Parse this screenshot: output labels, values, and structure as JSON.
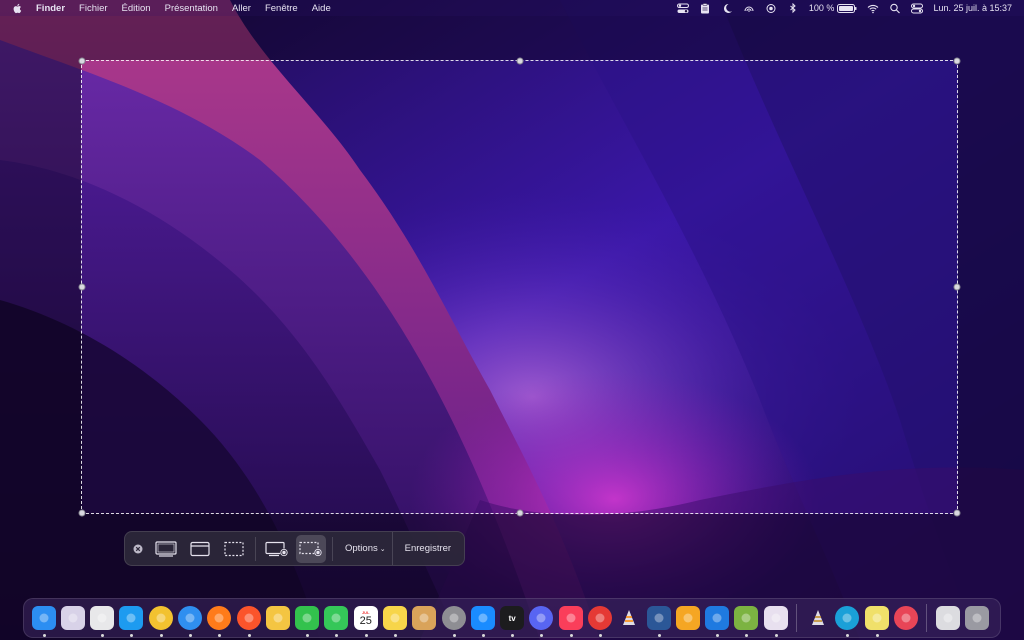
{
  "menubar": {
    "app_name": "Finder",
    "menus": [
      "Fichier",
      "Édition",
      "Présentation",
      "Aller",
      "Fenêtre",
      "Aide"
    ],
    "battery_percent": "100 %",
    "datetime": "Lun. 25 juil. à  15:37"
  },
  "toolbar": {
    "options_label": "Options",
    "record_label": "Enregistrer",
    "buttons": [
      "close-icon",
      "capture-entire-screen-icon",
      "capture-selected-window-icon",
      "capture-selected-portion-icon",
      "record-entire-screen-icon",
      "record-selected-portion-icon"
    ],
    "active": "record-selected-portion-icon"
  },
  "dock": {
    "calendar_day": "25",
    "calendar_month": "JUL",
    "tv_label": "tv",
    "apps": [
      {
        "name": "finder",
        "color": "#2c8ef2"
      },
      {
        "name": "launchpad",
        "color": "#d8d2e8"
      },
      {
        "name": "notes-dark",
        "color": "#e8e8ea"
      },
      {
        "name": "twitter",
        "color": "#1d9bf0"
      },
      {
        "name": "chrome",
        "color": "#f2c230"
      },
      {
        "name": "safari",
        "color": "#2f8ff0"
      },
      {
        "name": "firefox",
        "color": "#ff7b1a"
      },
      {
        "name": "brave",
        "color": "#fb542b"
      },
      {
        "name": "photos",
        "color": "#f4c542"
      },
      {
        "name": "facetime",
        "color": "#33c24d"
      },
      {
        "name": "messages",
        "color": "#35c759"
      },
      {
        "name": "calendar",
        "color": "#ffffff"
      },
      {
        "name": "notes",
        "color": "#f7d54a"
      },
      {
        "name": "preview",
        "color": "#d9a35a"
      },
      {
        "name": "system-preferences",
        "color": "#8e8e93"
      },
      {
        "name": "app-store",
        "color": "#1a8cff"
      },
      {
        "name": "apple-tv",
        "color": "#1c1c1e"
      },
      {
        "name": "discord",
        "color": "#5865f2"
      },
      {
        "name": "music",
        "color": "#fa3e5a"
      },
      {
        "name": "youtube-music",
        "color": "#e53935"
      },
      {
        "name": "vlc",
        "color": "#ff8800"
      },
      {
        "name": "word",
        "color": "#2b5797"
      },
      {
        "name": "pencil",
        "color": "#f5a623"
      },
      {
        "name": "xcode-tools",
        "color": "#1f7ae0"
      },
      {
        "name": "android",
        "color": "#7cb342"
      },
      {
        "name": "slack",
        "color": "#e8e0ef"
      },
      {
        "name": "vlc-hd",
        "color": "#c08a20"
      },
      {
        "name": "edge",
        "color": "#1aa0d8"
      },
      {
        "name": "stickies",
        "color": "#f0e06a"
      },
      {
        "name": "airmail",
        "color": "#e84557"
      },
      {
        "name": "downloads",
        "color": "#dcdce0"
      },
      {
        "name": "trash",
        "color": "#9a9aa2"
      }
    ]
  },
  "colors": {
    "selection_border": "#ffffff",
    "toolbar_bg": "#2d283a",
    "menubar_text": "#e7e3f2"
  }
}
